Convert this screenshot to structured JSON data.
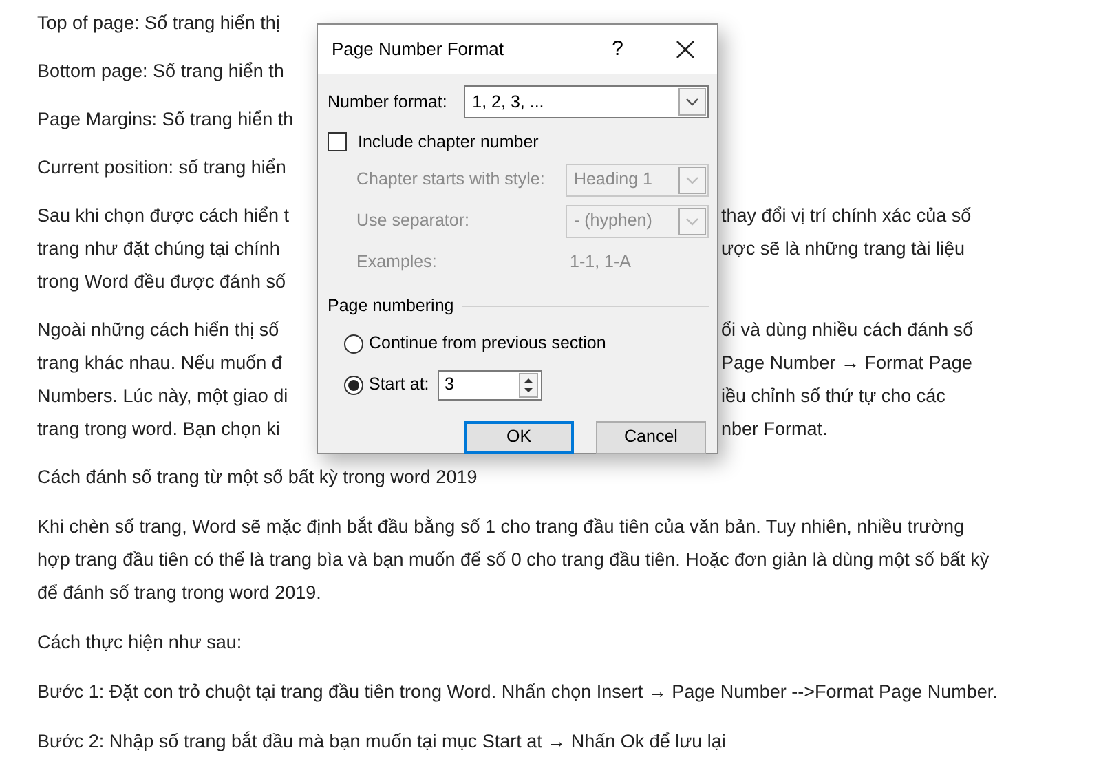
{
  "article": {
    "paragraphs_beside_dialog": [
      {
        "lines": [
          {
            "left": "Top of page: Số trang hiển thị"
          }
        ]
      },
      {
        "lines": [
          {
            "left": "Bottom page: Số trang hiển th"
          }
        ]
      },
      {
        "lines": [
          {
            "left": "Page Margins: Số trang hiển th"
          }
        ]
      },
      {
        "lines": [
          {
            "left": "Current position: số trang hiển"
          }
        ]
      },
      {
        "lines": [
          {
            "left": "Sau khi chọn được cách hiển t",
            "right": "thay đổi vị trí chính xác của số"
          },
          {
            "left": "trang như đặt chúng tại chính",
            "right": "ược sẽ là những trang tài liệu"
          },
          {
            "left": "trong Word đều được đánh số"
          }
        ]
      },
      {
        "lines": [
          {
            "left": "Ngoài những cách hiển thị số",
            "right": "ổi và dùng nhiều cách đánh số"
          },
          {
            "left": "trang khác nhau. Nếu muốn đ",
            "right": "Page Number → Format Page"
          },
          {
            "left": "Numbers. Lúc này, một giao di",
            "right": "iều chỉnh số thứ tự cho các"
          },
          {
            "left": "trang trong word. Bạn chọn ki",
            "right": "nber Format."
          }
        ]
      }
    ],
    "paragraphs": [
      "Cách đánh số trang từ một số bất kỳ trong word 2019",
      "Khi chèn số trang, Word sẽ mặc định bắt đầu bằng số 1 cho trang đầu tiên của văn bản. Tuy nhiên, nhiều trường hợp trang đầu tiên có thể là trang bìa và bạn muốn để số 0 cho trang đầu tiên. Hoặc đơn giản là dùng một số bất kỳ để đánh số trang trong word 2019.",
      "Cách thực hiện như sau:",
      "Bước 1: Đặt con trỏ chuột tại trang đầu tiên trong Word. Nhấn chọn Insert → Page Number -->Format Page Number.",
      "Bước 2: Nhập số trang bắt đầu mà bạn muốn tại mục Start at → Nhấn Ok để lưu lại"
    ]
  },
  "dialog": {
    "title": "Page Number Format",
    "help": "?",
    "number_format": {
      "label": "Number format:",
      "value": "1, 2, 3, ..."
    },
    "include_chapter_number": {
      "label": "Include chapter number",
      "checked": false
    },
    "chapter_fields": [
      {
        "kind": "select",
        "label": "Chapter starts with style:",
        "value": "Heading 1",
        "disabled": true
      },
      {
        "kind": "select",
        "label": "Use separator:",
        "value": "-   (hyphen)",
        "disabled": true
      },
      {
        "kind": "text",
        "label": "Examples:",
        "value": "1-1, 1-A",
        "disabled": true
      }
    ],
    "page_numbering": {
      "title": "Page numbering",
      "options": [
        {
          "kind": "plain",
          "label": "Continue from previous section",
          "selected": false
        },
        {
          "kind": "spinner",
          "label": "Start at:",
          "selected": true,
          "value": "3"
        }
      ]
    },
    "buttons": [
      {
        "label": "OK",
        "default": true
      },
      {
        "label": "Cancel",
        "default": false
      }
    ]
  }
}
